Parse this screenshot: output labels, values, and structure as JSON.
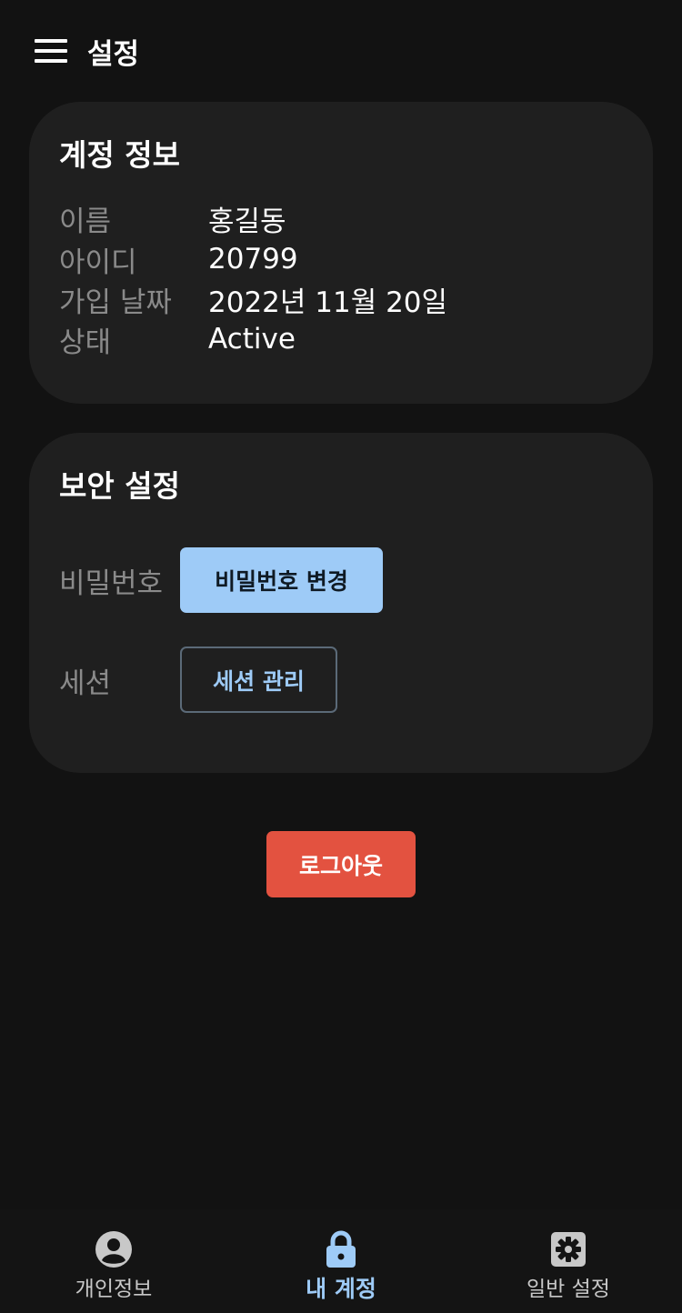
{
  "appbar": {
    "title": "설정",
    "menu_icon": "menu-icon"
  },
  "account_card": {
    "title": "계정 정보",
    "rows": [
      {
        "label": "이름",
        "value": "홍길동"
      },
      {
        "label": "아이디",
        "value": "20799"
      },
      {
        "label": "가입 날짜",
        "value": "2022년 11월 20일"
      },
      {
        "label": "상태",
        "value": "Active"
      }
    ]
  },
  "security_card": {
    "title": "보안 설정",
    "password": {
      "label": "비밀번호",
      "button": "비밀번호 변경"
    },
    "session": {
      "label": "세션",
      "button": "세션 관리"
    }
  },
  "logout": {
    "label": "로그아웃"
  },
  "bottom_nav": {
    "items": [
      {
        "label": "개인정보",
        "icon": "account-circle-icon",
        "active": false
      },
      {
        "label": "내 계정",
        "icon": "lock-icon",
        "active": true
      },
      {
        "label": "일반 설정",
        "icon": "settings-icon",
        "active": false
      }
    ]
  },
  "colors": {
    "background": "#121212",
    "card": "#1f1f1f",
    "accent": "#9ecbf7",
    "danger": "#e35240",
    "muted_label": "#8a8a8a"
  }
}
